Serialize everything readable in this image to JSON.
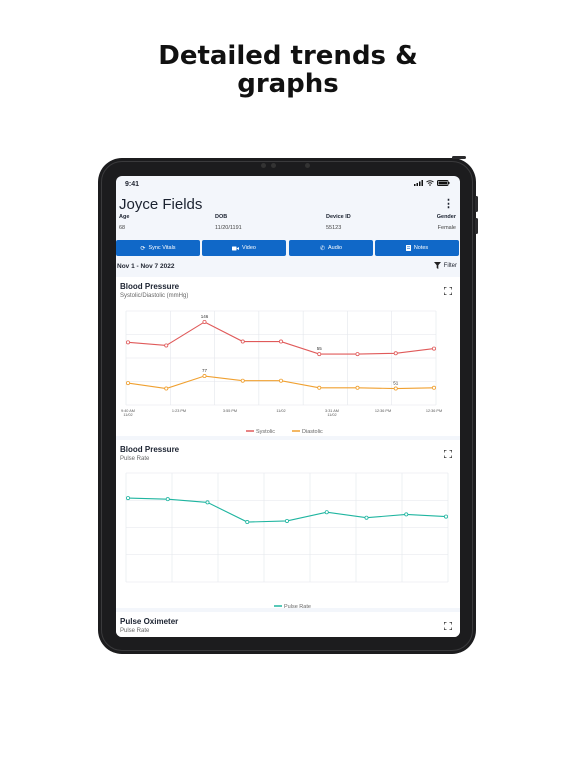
{
  "headline": {
    "line1": "Detailed trends &",
    "line2": "graphs"
  },
  "status_bar": {
    "time": "9:41"
  },
  "patient": {
    "name": "Joyce Fields",
    "fields": [
      {
        "label": "Age",
        "value": "68"
      },
      {
        "label": "DOB",
        "value": "11/20/1191"
      },
      {
        "label": "Device ID",
        "value": "55123"
      },
      {
        "label": "Gender",
        "value": "Female"
      }
    ]
  },
  "actions": [
    {
      "label": "Sync Vitals",
      "icon": "sync-icon"
    },
    {
      "label": "Video",
      "icon": "video-icon"
    },
    {
      "label": "Audio",
      "icon": "phone-icon"
    },
    {
      "label": "Notes",
      "icon": "notes-icon"
    }
  ],
  "date_range": "Nov 1 - Nov 7 2022",
  "filter_label": "Filter",
  "colors": {
    "primary": "#1068c8",
    "systolic": "#e05a5a",
    "diastolic": "#f0a030",
    "pulse": "#1fb5a0"
  },
  "cards": [
    {
      "title": "Blood Pressure",
      "subtitle": "Systolic/Diastolic (mmHg)"
    },
    {
      "title": "Blood Pressure",
      "subtitle": "Pulse Rate"
    },
    {
      "title": "Pulse Oximeter",
      "subtitle": "Pulse Rate"
    }
  ],
  "chart_data": [
    {
      "type": "line",
      "title": "Blood Pressure",
      "subtitle": "Systolic/Diastolic (mmHg)",
      "x_ticks": [
        "9:40 AM 11/02",
        "1:23 PM",
        "3:55 PM",
        "11/02",
        "3:31 AM 11/02",
        "12:36 PM",
        "12:36 PM"
      ],
      "ylim": [
        40,
        160
      ],
      "series": [
        {
          "name": "Systolic",
          "values": [
            120,
            116,
            146,
            121,
            121,
            105,
            105,
            106,
            112
          ],
          "labels": {
            "2": "146",
            "5": "55"
          }
        },
        {
          "name": "Diastolic",
          "values": [
            68,
            61,
            77,
            71,
            71,
            62,
            62,
            61,
            62
          ],
          "labels": {
            "2": "77",
            "7": "51"
          }
        }
      ],
      "grid": true,
      "legend": "bottom"
    },
    {
      "type": "line",
      "title": "Blood Pressure",
      "subtitle": "Pulse Rate",
      "ylim": [
        0,
        100
      ],
      "series": [
        {
          "name": "Pulse Rate",
          "values": [
            77,
            76,
            73,
            55,
            56,
            64,
            59,
            62,
            60
          ]
        }
      ],
      "grid": true,
      "legend": "bottom"
    }
  ]
}
